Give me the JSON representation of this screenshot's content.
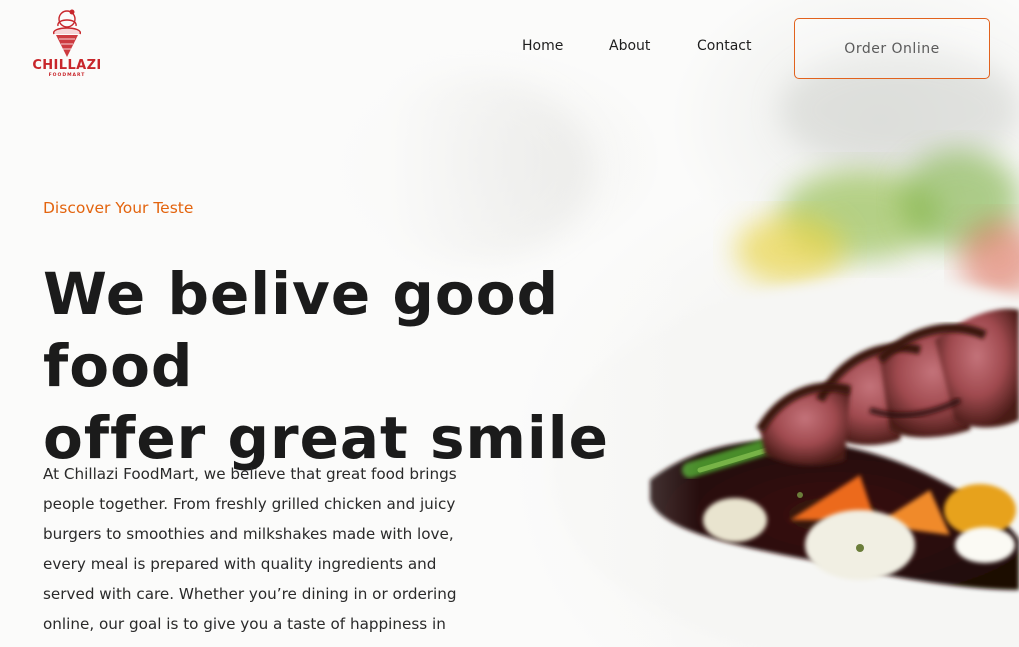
{
  "brand": {
    "logo_alt": "Chillazi FoodMart logo",
    "logo_text": "CHILLAZI",
    "logo_subtext": "FOODMART",
    "accent_color": "#e1621d",
    "logo_color": "#c8262b"
  },
  "nav": {
    "items": [
      {
        "label": "Home"
      },
      {
        "label": "About"
      },
      {
        "label": "Contact"
      }
    ],
    "cta_label": "Order Online"
  },
  "hero": {
    "eyebrow": "Discover Your Teste",
    "headline_line1": "We belive good food",
    "headline_line2": "offer great smile",
    "body": "At Chillazi FoodMart, we believe that great food brings people together. From freshly grilled chicken and juicy burgers to smoothies and milkshakes made with love, every meal is prepared with quality ingredients and served with care. Whether you’re dining in or ordering online, our goal is to give you a taste of happiness in every bite."
  },
  "icons": {
    "logo": "ice-cream-cone-logo"
  }
}
